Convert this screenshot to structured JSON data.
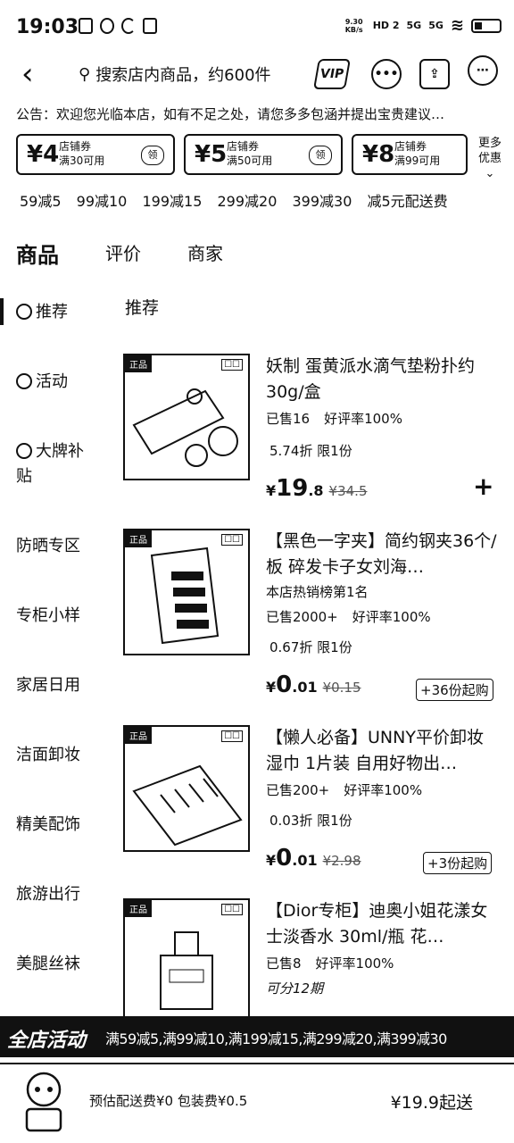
{
  "status": {
    "time": "19:03",
    "net_speed": "9.30 KB/s",
    "hd": "HD 2",
    "sig1": "5G",
    "sig2": "5G"
  },
  "header": {
    "search_placeholder": "搜索店内商品，约600件",
    "notice": "公告：欢迎您光临本店，如有不足之处，请您多多包涵并提出宝贵建议…"
  },
  "coupons": [
    {
      "amount": "¥4",
      "line1": "店铺券",
      "line2": "满30可用",
      "get": "领"
    },
    {
      "amount": "¥5",
      "line1": "店铺券",
      "line2": "满50可用",
      "get": "领"
    },
    {
      "amount": "¥8",
      "line1": "店铺券",
      "line2": "满99可用",
      "get": "领"
    }
  ],
  "more_label": "更多优惠",
  "deals": [
    "59减5",
    "99减10",
    "199减15",
    "299减20",
    "399减30",
    "减5元配送费"
  ],
  "tabs": [
    "商品",
    "评价",
    "商家"
  ],
  "sidebar": [
    "推荐",
    "活动",
    "大牌补贴",
    "防晒专区",
    "专柜小样",
    "家居日用",
    "洁面卸妆",
    "精美配饰",
    "旅游出行",
    "美腿丝袜"
  ],
  "section_title": "推荐",
  "products": [
    {
      "title": "妖制 蛋黄派水滴气垫粉扑约30g/盒",
      "tag": "",
      "sold": "已售16",
      "rating": "好评率100%",
      "discount": "5.74折 限1份",
      "price_sym": "¥",
      "price_int": "19",
      "price_dec": ".8",
      "orig": "¥34.5",
      "action": "+"
    },
    {
      "title": "【黑色一字夹】简约钢夹36个/板 碎发卡子女刘海…",
      "tag": "本店热销榜第1名",
      "sold": "已售2000+",
      "rating": "好评率100%",
      "discount": "0.67折 限1份",
      "price_sym": "¥",
      "price_int": "0",
      "price_dec": ".01",
      "orig": "¥0.15",
      "action": "+36份起购"
    },
    {
      "title": "【懒人必备】UNNY平价卸妆湿巾 1片装 自用好物出…",
      "tag": "",
      "sold": "已售200+",
      "rating": "好评率100%",
      "discount": "0.03折 限1份",
      "price_sym": "¥",
      "price_int": "0",
      "price_dec": ".01",
      "orig": "¥2.98",
      "action": "+3份起购"
    },
    {
      "title": "【Dior专柜】迪奥小姐花漾女士淡香水 30ml/瓶 花…",
      "tag": "",
      "sold": "已售8",
      "rating": "好评率100%",
      "discount": "可分12期",
      "price_sym": "",
      "price_int": "",
      "price_dec": "",
      "orig": "",
      "action": ""
    }
  ],
  "promo": {
    "label": "全店活动",
    "text": "满59减5,满99减10,满199减15,满299减20,满399减30"
  },
  "cart": {
    "fee": "预估配送费¥0 包装费¥0.5",
    "min": "¥19.9起送"
  }
}
